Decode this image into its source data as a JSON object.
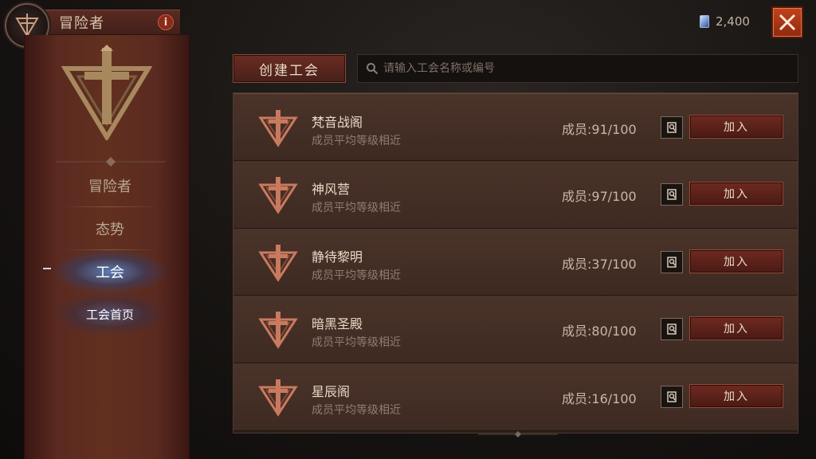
{
  "header": {
    "title": "冒险者",
    "info_icon_label": "i"
  },
  "sidebar": {
    "items": [
      {
        "label": "冒险者",
        "active": false
      },
      {
        "label": "态势",
        "active": false
      },
      {
        "label": "工会",
        "active": true
      }
    ],
    "sub_items": [
      {
        "label": "工会首页",
        "active": true
      }
    ]
  },
  "currency": {
    "icon": "crystal-gem-icon",
    "amount": "2,400"
  },
  "toolbar": {
    "create_label": "创建工会",
    "search_placeholder": "请输入工会名称或编号"
  },
  "guilds": [
    {
      "name": "梵音战阁",
      "note": "成员平均等级相近",
      "members": "成员:91/100",
      "join_label": "加入"
    },
    {
      "name": "神风营",
      "note": "成员平均等级相近",
      "members": "成员:97/100",
      "join_label": "加入"
    },
    {
      "name": "静待黎明",
      "note": "成员平均等级相近",
      "members": "成员:37/100",
      "join_label": "加入"
    },
    {
      "name": "暗黑圣殿",
      "note": "成员平均等级相近",
      "members": "成员:80/100",
      "join_label": "加入"
    },
    {
      "name": "星辰阁",
      "note": "成员平均等级相近",
      "members": "成员:16/100",
      "join_label": "加入"
    }
  ],
  "colors": {
    "accent_red": "#8f2a10",
    "active_glow": "#5a96e6",
    "banner": "#5b2a20"
  }
}
